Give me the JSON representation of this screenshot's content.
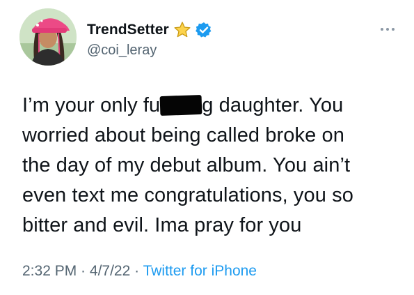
{
  "tweet": {
    "display_name": "TrendSetter",
    "handle": "@coi_leray",
    "badge_star_icon": "star-icon",
    "badge_verified_icon": "verified-badge-icon",
    "more_icon": "more-options-icon",
    "text": {
      "line1_prefix": "I’m your only fu",
      "line1_suffix": "g daughter. You",
      "line2": "worried about being called broke on",
      "line3": "the day of my debut album. You ain’t",
      "line4": "even text me congratulations, you so",
      "line5": "bitter and evil. Ima pray for you"
    },
    "time": "2:32 PM",
    "separator1": " · ",
    "date": "4/7/22",
    "separator2": " · ",
    "source": "Twitter for iPhone",
    "colors": {
      "link": "#1d9bf0",
      "secondary": "#536471",
      "star": "#f5c518",
      "verified": "#1d9bf0"
    }
  }
}
